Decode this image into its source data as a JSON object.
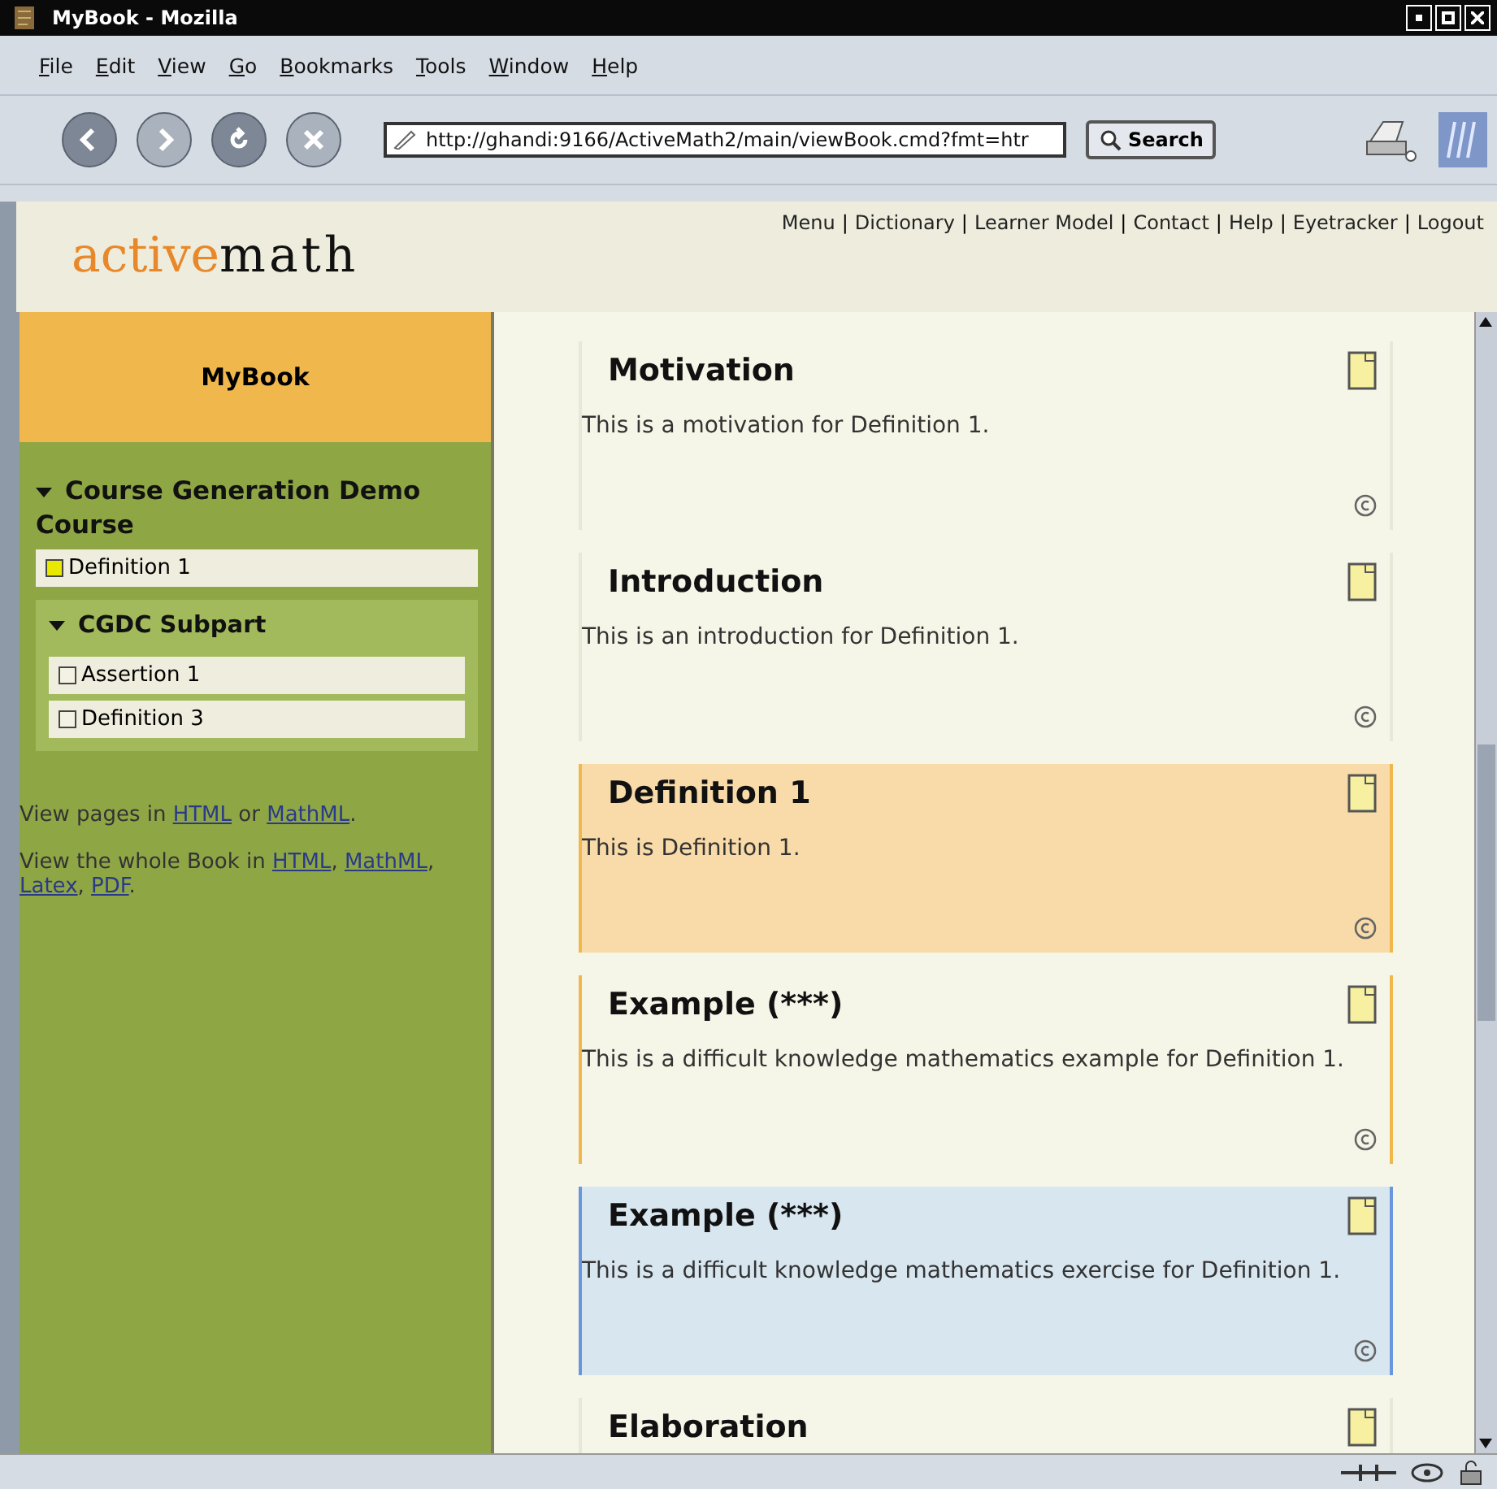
{
  "window": {
    "title": "MyBook - Mozilla"
  },
  "menu": [
    "File",
    "Edit",
    "View",
    "Go",
    "Bookmarks",
    "Tools",
    "Window",
    "Help"
  ],
  "toolbar": {
    "url": "http://ghandi:9166/ActiveMath2/main/viewBook.cmd?fmt=htr",
    "search": "Search"
  },
  "header": {
    "logo_left": "active",
    "logo_right": "math",
    "separator": "|",
    "links": [
      "Menu",
      "Dictionary",
      "Learner Model",
      "Contact",
      "Help",
      "Eyetracker",
      "Logout"
    ]
  },
  "sidebar": {
    "title": "MyBook",
    "tree": [
      {
        "label": "Course Generation Demo Course",
        "expanded": true,
        "children": [
          {
            "label": "Definition 1",
            "selected": true
          },
          {
            "label": "CGDC Subpart",
            "expanded": true,
            "children": [
              {
                "label": "Assertion 1",
                "selected": false
              },
              {
                "label": "Definition 3",
                "selected": false
              }
            ]
          }
        ]
      }
    ],
    "notes": [
      [
        {
          "kind": "text",
          "text": "View pages in "
        },
        {
          "kind": "link",
          "text": "HTML"
        },
        {
          "kind": "text",
          "text": " or "
        },
        {
          "kind": "link",
          "text": "MathML"
        },
        {
          "kind": "text",
          "text": "."
        }
      ],
      [
        {
          "kind": "text",
          "text": "View the whole Book in "
        },
        {
          "kind": "link",
          "text": "HTML"
        },
        {
          "kind": "text",
          "text": ", "
        },
        {
          "kind": "link",
          "text": "MathML"
        },
        {
          "kind": "text",
          "text": ", "
        },
        {
          "kind": "link",
          "text": "Latex"
        },
        {
          "kind": "text",
          "text": ", "
        },
        {
          "kind": "link",
          "text": "PDF"
        },
        {
          "kind": "text",
          "text": "."
        }
      ]
    ]
  },
  "items": [
    {
      "kind": "plain",
      "title": "Motivation",
      "text": "This is a motivation for Definition 1."
    },
    {
      "kind": "plain",
      "title": "Introduction",
      "text": "This is an introduction for Definition 1."
    },
    {
      "kind": "current",
      "title": "Definition 1",
      "text": "This is Definition 1."
    },
    {
      "kind": "example",
      "title": "Example (***)",
      "text": "This is a difficult knowledge mathematics example for Definition 1."
    },
    {
      "kind": "exercise",
      "title": "Example (***)",
      "text": "This is a difficult knowledge mathematics exercise for Definition 1."
    },
    {
      "kind": "plain",
      "title": "Elaboration"
    }
  ]
}
